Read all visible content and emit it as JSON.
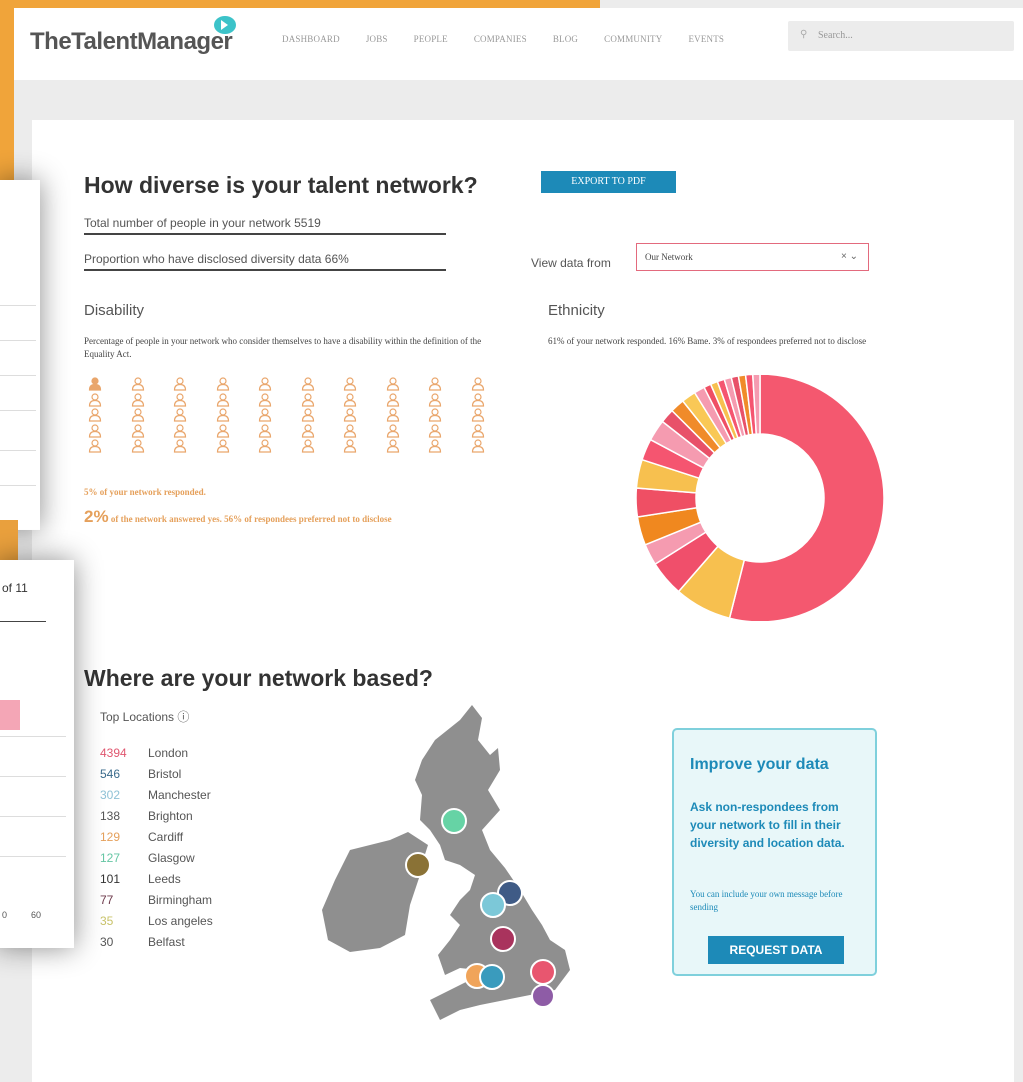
{
  "header": {
    "logo": "TheTalentManager",
    "nav": [
      "DASHBOARD",
      "JOBS",
      "PEOPLE",
      "COMPANIES",
      "BLOG",
      "COMMUNITY",
      "EVENTS"
    ],
    "search_placeholder": "Search..."
  },
  "page": {
    "title": "How diverse is your talent network?",
    "export_label": "EXPORT TO PDF",
    "total_people": "Total number of people in your network 5519",
    "disclosed": "Proportion who have disclosed diversity data 66%",
    "view_label": "View data from",
    "view_value": "Our Network"
  },
  "disability": {
    "heading": "Disability",
    "description": "Percentage of people in your network who consider themselves to have a disability within the definition of the Equality Act.",
    "responded": "5% of your network responded.",
    "answer_big": "2%",
    "answer_rest": " of the network answered yes. 56% of respondees preferred not to disclose",
    "highlighted_count": 1,
    "total_icons": 50,
    "icon_color": "#e9a66c"
  },
  "ethnicity": {
    "heading": "Ethnicity",
    "description": "61% of your network responded. 16% Bame. 3% of respondees preferred not to disclose"
  },
  "chart_data": {
    "type": "pie",
    "donut": true,
    "values": [
      58,
      8,
      5,
      3,
      4,
      4,
      4,
      3,
      3,
      2,
      2,
      2,
      1.5,
      1,
      1,
      1,
      1,
      1,
      1,
      1,
      1
    ],
    "colors": [
      "#f4586f",
      "#f7c04f",
      "#f04f6b",
      "#f59bb0",
      "#f0881f",
      "#ef4f64",
      "#f7c04f",
      "#f55570",
      "#f59bb0",
      "#e85169",
      "#f08b2a",
      "#f9c856",
      "#f59bb0",
      "#ef4f64",
      "#f7c04f",
      "#f55570",
      "#f59bb0",
      "#e85169",
      "#f08b2a",
      "#f55570",
      "#f59bb0"
    ]
  },
  "locations": {
    "heading": "Where are your network based?",
    "top_label": "Top Locations ⓘ",
    "items": [
      {
        "count": "4394",
        "city": "London",
        "color": "#e0566f"
      },
      {
        "count": "546",
        "city": "Bristol",
        "color": "#3a6b8c"
      },
      {
        "count": "302",
        "city": "Manchester",
        "color": "#8fc2d6"
      },
      {
        "count": "138",
        "city": "Brighton",
        "color": "#555555"
      },
      {
        "count": "129",
        "city": "Cardiff",
        "color": "#e5a05b"
      },
      {
        "count": "127",
        "city": "Glasgow",
        "color": "#66c6a4"
      },
      {
        "count": "101",
        "city": "Leeds",
        "color": "#333333"
      },
      {
        "count": "77",
        "city": "Birmingham",
        "color": "#6d3a4b"
      },
      {
        "count": "35",
        "city": "Los angeles",
        "color": "#c9c36a"
      },
      {
        "count": "30",
        "city": "Belfast",
        "color": "#555555"
      }
    ]
  },
  "improve": {
    "heading": "Improve your data",
    "text": "Ask non-respondees from your network to fill in their diversity and location data.",
    "small": "You can include your own message before sending",
    "button": "REQUEST DATA"
  },
  "overlay": {
    "page_of": "of 11",
    "tick_a": "0",
    "tick_b": "60"
  }
}
